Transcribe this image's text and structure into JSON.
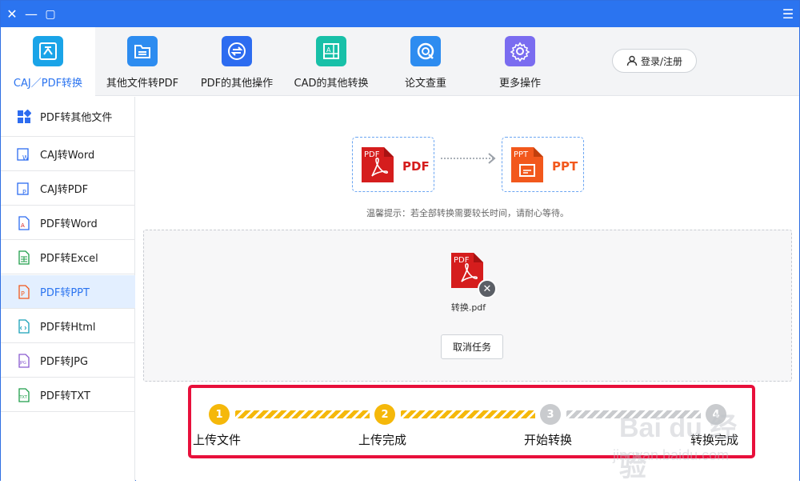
{
  "window": {
    "close_glyph": "✕",
    "minimize_glyph": "—",
    "maximize_glyph": "▢",
    "menu_glyph": "☰"
  },
  "topnav": {
    "items": [
      {
        "label": "CAJ／PDF转换",
        "icon": "pdf-convert-icon",
        "color": "#1aa4e8"
      },
      {
        "label": "其他文件转PDF",
        "icon": "folder-icon",
        "color": "#2d8cf0"
      },
      {
        "label": "PDF的其他操作",
        "icon": "swap-icon",
        "color": "#2d6cf0"
      },
      {
        "label": "CAD的其他转换",
        "icon": "cad-icon",
        "color": "#18c0a8"
      },
      {
        "label": "论文查重",
        "icon": "check-search-icon",
        "color": "#2d8cf0"
      },
      {
        "label": "更多操作",
        "icon": "gear-icon",
        "color": "#7a6cf0"
      }
    ],
    "login_label": "登录/注册"
  },
  "sidebar": {
    "items": [
      {
        "label": "PDF转其他文件",
        "icon": "grid-icon"
      },
      {
        "label": "CAJ转Word",
        "icon": "caj-word-icon"
      },
      {
        "label": "CAJ转PDF",
        "icon": "caj-pdf-icon"
      },
      {
        "label": "PDF转Word",
        "icon": "pdf-word-icon"
      },
      {
        "label": "PDF转Excel",
        "icon": "pdf-excel-icon"
      },
      {
        "label": "PDF转PPT",
        "icon": "pdf-ppt-icon"
      },
      {
        "label": "PDF转Html",
        "icon": "pdf-html-icon"
      },
      {
        "label": "PDF转JPG",
        "icon": "pdf-jpg-icon"
      },
      {
        "label": "PDF转TXT",
        "icon": "pdf-txt-icon"
      }
    ],
    "active_index": 5
  },
  "main": {
    "from_format": "PDF",
    "to_format": "PPT",
    "from_badge": "PDF",
    "to_badge": "PPT",
    "from_color": "#d51d1d",
    "to_color": "#f2581c",
    "hint": "温馨提示：若全部转换需要较长时间，请耐心等待。",
    "file_badge": "PDF",
    "file_name": "转换.pdf",
    "cancel_label": "取消任务",
    "remove_glyph": "✕"
  },
  "progress": {
    "steps": [
      {
        "number": "1",
        "label": "上传文件",
        "status": "done"
      },
      {
        "number": "2",
        "label": "上传完成",
        "status": "done"
      },
      {
        "number": "3",
        "label": "开始转换",
        "status": "todo"
      },
      {
        "number": "4",
        "label": "转换完成",
        "status": "todo"
      }
    ],
    "done_color": "#f5b80a",
    "todo_color": "#c9cbce",
    "highlight_color": "#e8103b"
  },
  "watermark": {
    "line1": "Bai du 经验",
    "line2": "jingyan.baidu.com"
  }
}
